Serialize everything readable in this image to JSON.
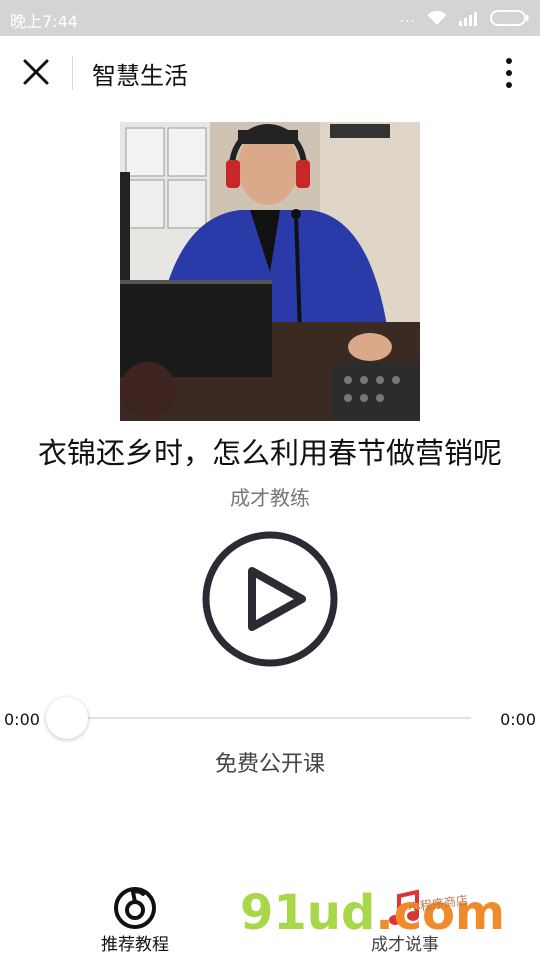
{
  "status_bar": {
    "time": "晚上7:44",
    "dots": "..."
  },
  "nav": {
    "title": "智慧生活"
  },
  "player": {
    "title": "衣锦还乡时，怎么利用春节做营销呢",
    "artist": "成才教练",
    "current_time": "0:00",
    "duration": "0:00",
    "progress": 0,
    "course_tag": "免费公开课"
  },
  "tabs": [
    {
      "label": "推荐教程",
      "icon": "netease-music-icon"
    },
    {
      "label": "成才说事",
      "icon": "music-note-icon"
    }
  ],
  "watermark": {
    "main": "91ud",
    "domain": ".com",
    "sub": "小程序商店"
  }
}
